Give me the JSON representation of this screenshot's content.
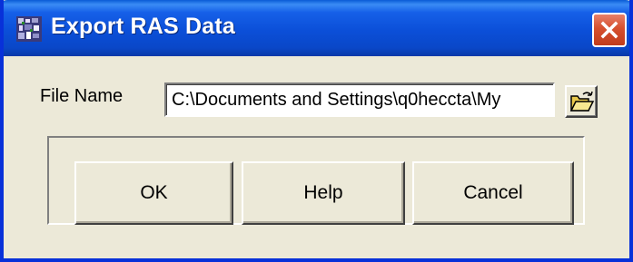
{
  "window": {
    "title": "Export RAS Data",
    "app_icon": "ras-app-icon",
    "close_icon": "close-icon"
  },
  "form": {
    "file_name_label": "File Name",
    "file_name_value": "C:\\Documents and Settings\\q0heccta\\My",
    "browse_icon": "open-folder-icon"
  },
  "buttons": {
    "ok_label": "OK",
    "help_label": "Help",
    "cancel_label": "Cancel"
  },
  "colors": {
    "titlebar_blue": "#0b4fd8",
    "dialog_background": "#ece9d8",
    "close_red": "#d6502e"
  }
}
